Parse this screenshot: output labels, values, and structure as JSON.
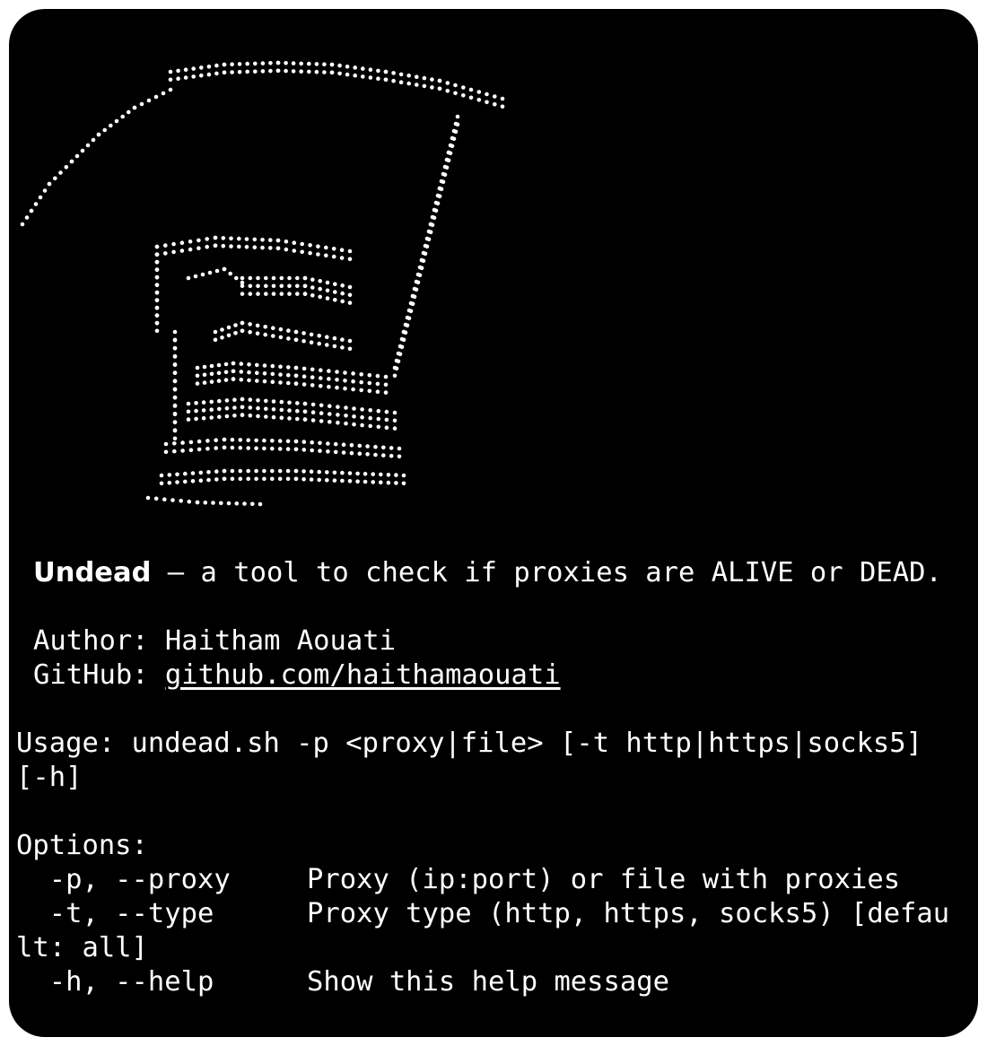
{
  "banner": {
    "name": "Undead",
    "tagline": " — a tool to check if proxies are ALIVE or DEAD.",
    "author_label": "Author: ",
    "author_value": "Haitham Aouati",
    "github_label": "GitHub: ",
    "github_link": "github.com/haithamaouati",
    "ascii_art_icon": "grim-reaper-scythe-braille-art"
  },
  "usage": {
    "line1": "Usage: undead.sh -p <proxy|file> [-t http|https|socks5]",
    "line2": "[-h]"
  },
  "options": {
    "heading": "Options:",
    "proxy_flag": "  -p, --proxy",
    "proxy_desc": "Proxy (ip:port) or file with proxies",
    "type_flag": "  -t, --type",
    "type_desc": "Proxy type (http, https, socks5) [defau",
    "type_wrap": "lt: all]",
    "help_flag": "  -h, --help",
    "help_desc": "Show this help message"
  },
  "colors": {
    "background": "#000000",
    "text": "#ffffff"
  }
}
